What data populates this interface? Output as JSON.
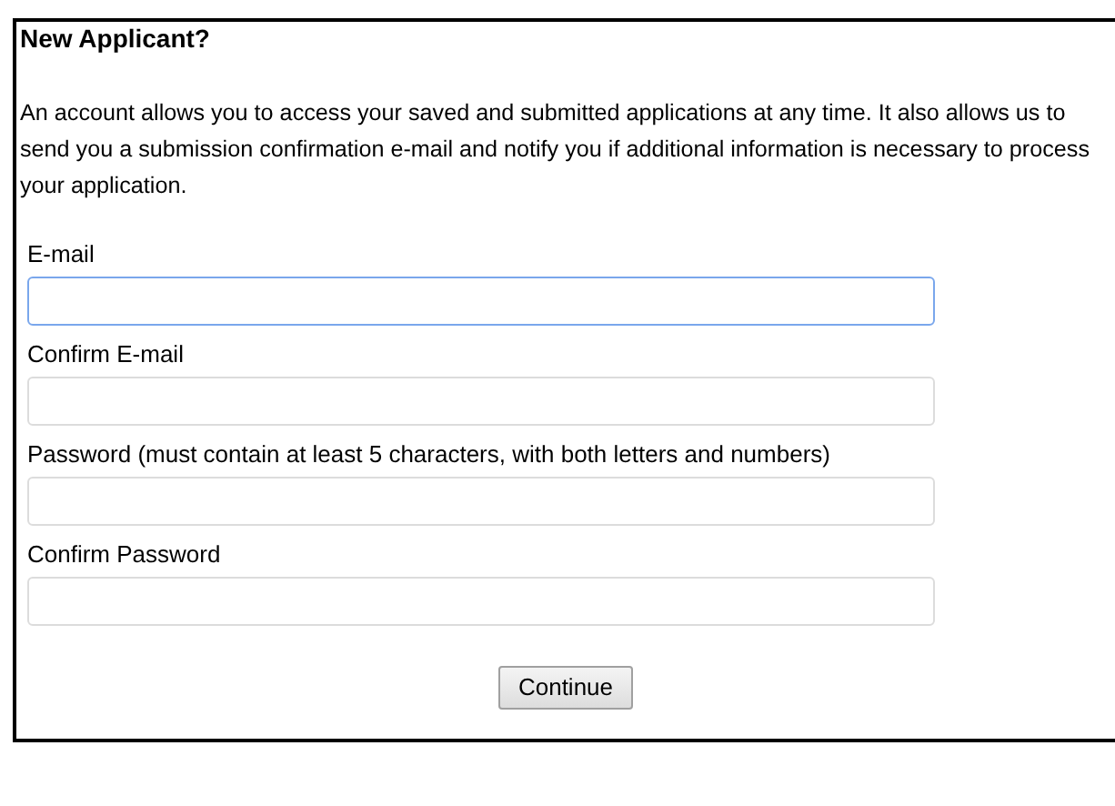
{
  "title": "New Applicant?",
  "intro": "An account allows you to access your saved and submitted applications at any time. It also allows us to send you a submission confirmation e-mail and notify you if additional information is necessary to process your application.",
  "fields": [
    {
      "label": "E-mail",
      "focused": true
    },
    {
      "label": "Confirm E-mail",
      "focused": false
    },
    {
      "label": "Password (must contain at least 5 characters, with both letters and numbers)",
      "focused": false
    },
    {
      "label": "Confirm Password",
      "focused": false
    }
  ],
  "button": "Continue"
}
